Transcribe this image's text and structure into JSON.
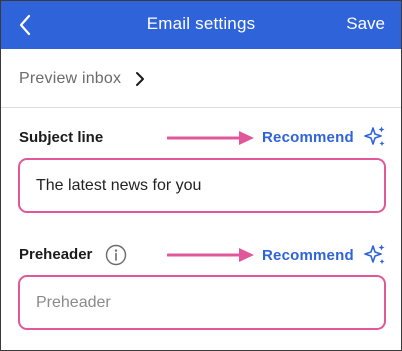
{
  "header": {
    "title": "Email settings",
    "save_label": "Save",
    "background": "#2f63d9"
  },
  "preview": {
    "label": "Preview inbox"
  },
  "subject": {
    "label": "Subject line",
    "recommend_label": "Recommend",
    "value": "The latest news for you"
  },
  "preheader": {
    "label": "Preheader",
    "recommend_label": "Recommend",
    "value": "",
    "placeholder": "Preheader"
  },
  "colors": {
    "accent": "#2f63d9",
    "highlight": "#e0589a"
  },
  "icons": [
    "back-chevron-icon",
    "chevron-right-icon",
    "info-icon",
    "sparkle-icon",
    "arrow-right-icon"
  ]
}
